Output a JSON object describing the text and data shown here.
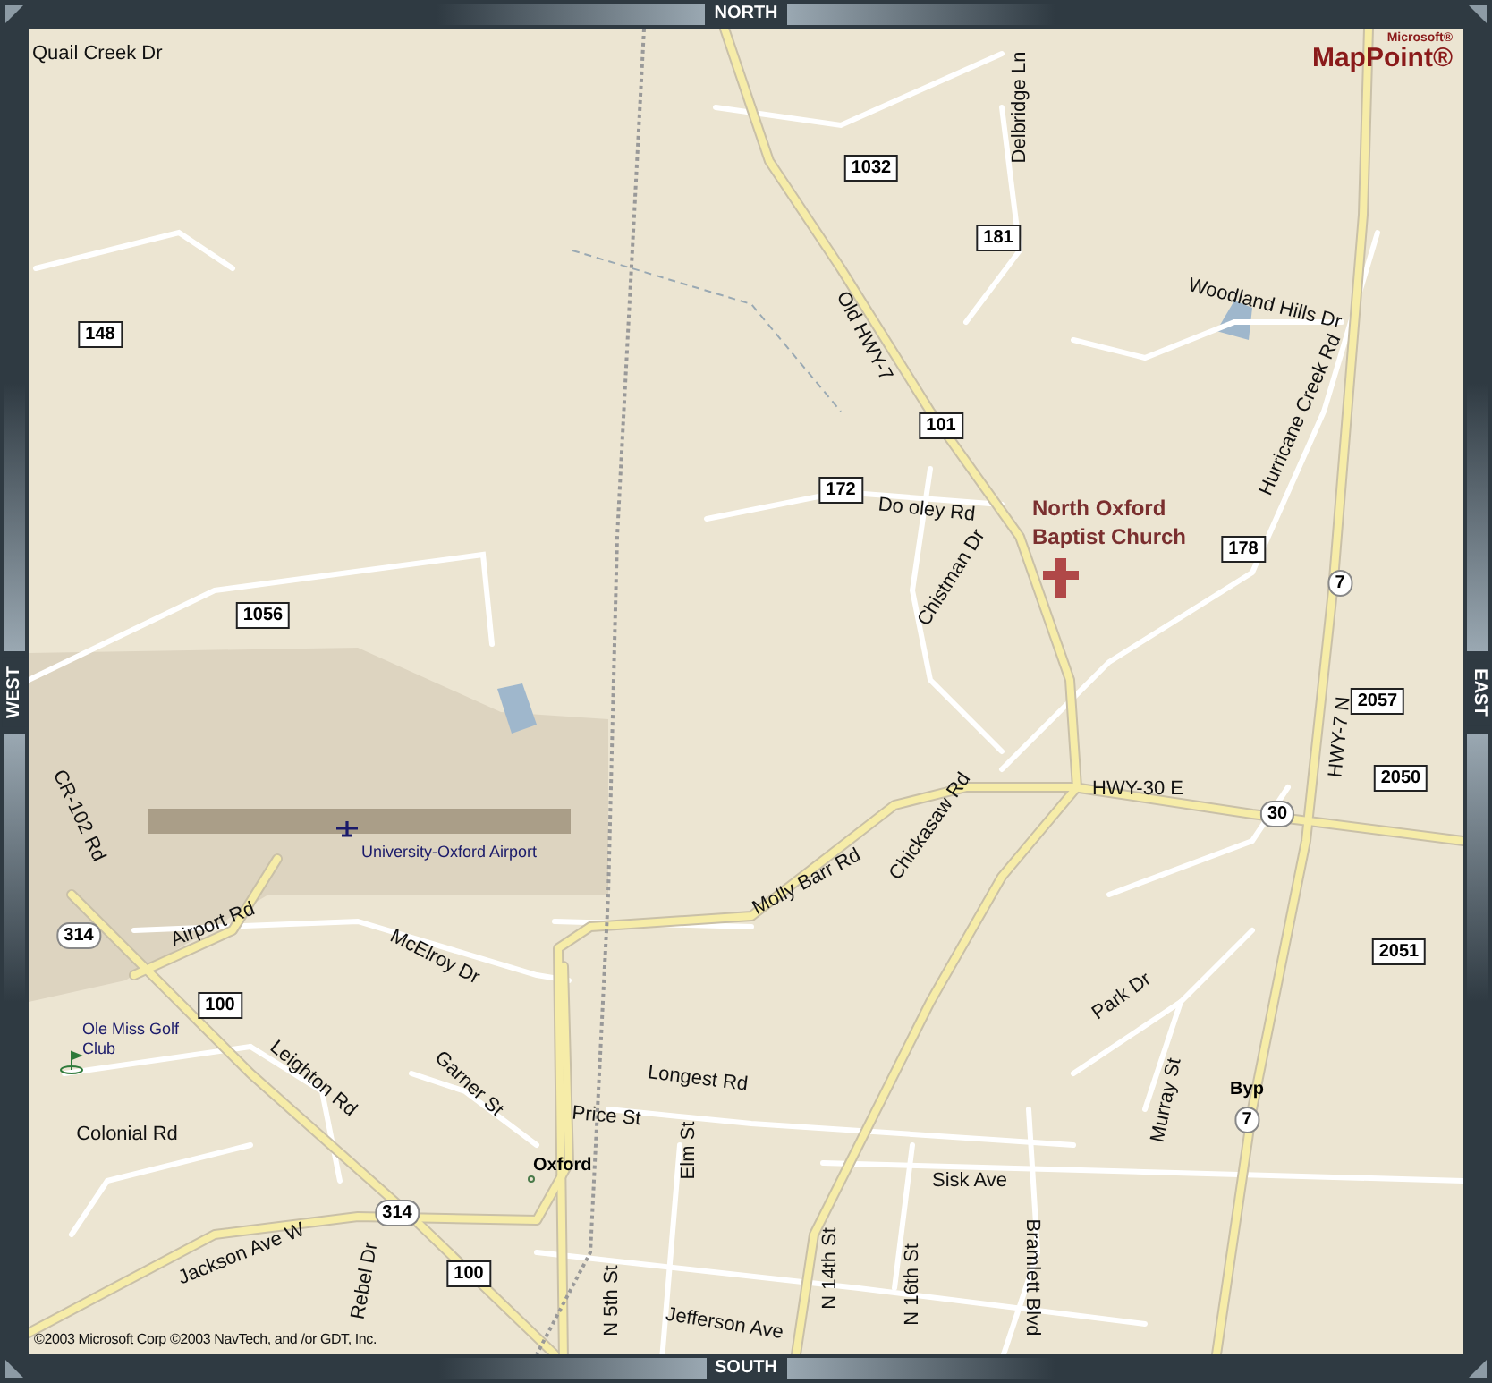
{
  "navigation": {
    "north": "NORTH",
    "east": "EAST",
    "south": "SOUTH",
    "west": "WEST"
  },
  "logo": {
    "brand": "Microsoft®",
    "product": "MapPoint®"
  },
  "map": {
    "street_labels": [
      "Quail Creek Dr",
      "Delbridge Ln",
      "Old HWY-7",
      "Woodland Hills Dr",
      "Hurricane Creek Rd",
      "Do oley Rd",
      "Chistman Dr",
      "HWY-30 E",
      "HWY-7 N",
      "Chickasaw Rd",
      "Molly Barr Rd",
      "CR-102 Rd",
      "Airport Rd",
      "McElroy Dr",
      "Leighton Rd",
      "Garner St",
      "Longest Rd",
      "Price St",
      "Colonial Rd",
      "Elm St",
      "Jackson Ave W",
      "Rebel Dr",
      "Sisk Ave",
      "Murray St",
      "Park Dr",
      "Jefferson Ave",
      "N 5th St",
      "N 14th St",
      "N 16th St",
      "Bramlett Blvd"
    ],
    "shields": [
      {
        "text": "1032",
        "kind": "square"
      },
      {
        "text": "181",
        "kind": "square"
      },
      {
        "text": "148",
        "kind": "square"
      },
      {
        "text": "101",
        "kind": "square"
      },
      {
        "text": "172",
        "kind": "square"
      },
      {
        "text": "178",
        "kind": "square"
      },
      {
        "text": "7",
        "kind": "round"
      },
      {
        "text": "1056",
        "kind": "square"
      },
      {
        "text": "2057",
        "kind": "square"
      },
      {
        "text": "2050",
        "kind": "square"
      },
      {
        "text": "30",
        "kind": "round"
      },
      {
        "text": "2051",
        "kind": "square"
      },
      {
        "text": "314",
        "kind": "round"
      },
      {
        "text": "100",
        "kind": "square"
      },
      {
        "text": "Byp",
        "kind": "plain"
      },
      {
        "text": "7",
        "kind": "round"
      },
      {
        "text": "314",
        "kind": "round"
      },
      {
        "text": "100",
        "kind": "square"
      }
    ],
    "places": [
      {
        "name": "University-Oxford Airport",
        "kind": "airport"
      },
      {
        "name": "Ole Miss Golf Club",
        "kind": "golf"
      },
      {
        "name": "Oxford",
        "kind": "town"
      }
    ],
    "point_of_interest": {
      "name": "North Oxford Baptist Church"
    }
  },
  "copyright": "©2003 Microsoft Corp ©2003 NavTech, and /or GDT, Inc."
}
